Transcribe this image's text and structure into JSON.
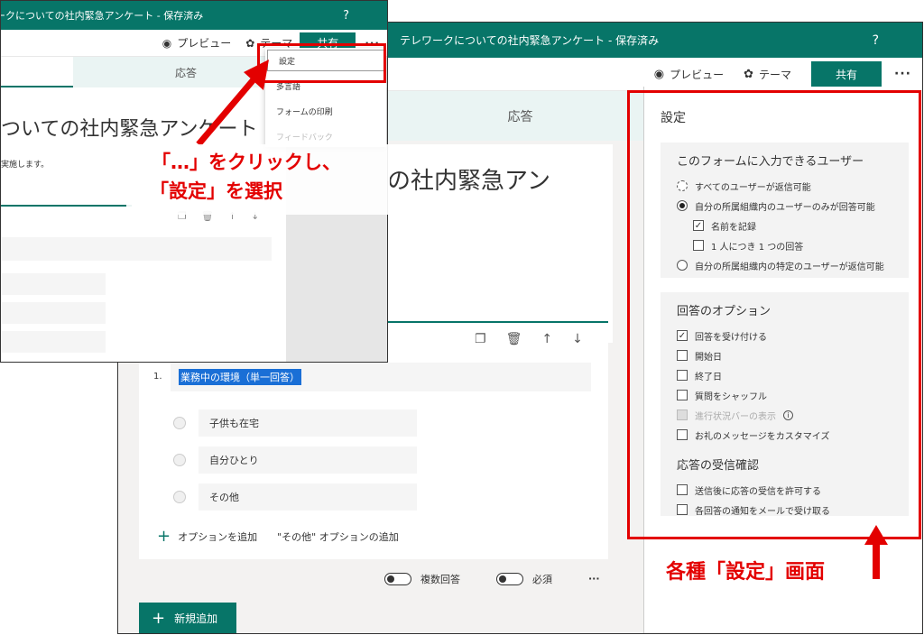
{
  "main": {
    "title": "テレワークについての社内緊急アンケート - 保存済み",
    "help": "?",
    "preview": "プレビュー",
    "theme": "テーマ",
    "share": "共有",
    "more": "···",
    "tab_responses": "応答",
    "form_title": "の社内緊急アン"
  },
  "settings": {
    "title": "設定",
    "who_title": "このフォームに入力できるユーザー",
    "who_all": "すべてのユーザーが返信可能",
    "who_org": "自分の所属組織内のユーザーのみが回答可能",
    "record_name": "名前を記録",
    "one_response": "1 人につき 1 つの回答",
    "who_specific": "自分の所属組織内の特定のユーザーが返信可能",
    "opt_title": "回答のオプション",
    "accept": "回答を受け付ける",
    "start_date": "開始日",
    "end_date": "終了日",
    "shuffle": "質問をシャッフル",
    "progress": "進行状況バーの表示",
    "thanks": "お礼のメッセージをカスタマイズ",
    "receipt_title": "応答の受信確認",
    "receipt_allow": "送信後に応答の受信を許可する",
    "email_notify": "各回答の通知をメールで受け取る"
  },
  "question": {
    "number": "1.",
    "text": "業務中の環境（単一回答）",
    "options": [
      "子供も在宅",
      "自分ひとり",
      "その他"
    ],
    "add_option": "オプションを追加",
    "add_other": "\"その他\" オプションの追加",
    "multiple": "複数回答",
    "required": "必須",
    "more": "···",
    "add_new": "新規追加"
  },
  "overlay": {
    "title": "ークについての社内緊急アンケート - 保存済み",
    "help": "?",
    "preview": "プレビュー",
    "theme": "テーマ",
    "share": "共有",
    "more": "···",
    "tab": "応答",
    "form_title": "ついての社内緊急アンケート",
    "desc": "実施します。",
    "menu": [
      "設定",
      "多言語",
      "フォームの印刷",
      "フィードバック"
    ]
  },
  "annotations": {
    "callout1": "「…」をクリックし、",
    "callout2": "「設定」を選択",
    "callout3": "各種「設定」画面"
  },
  "colors": {
    "accent": "#077568",
    "highlight": "#e30000"
  }
}
